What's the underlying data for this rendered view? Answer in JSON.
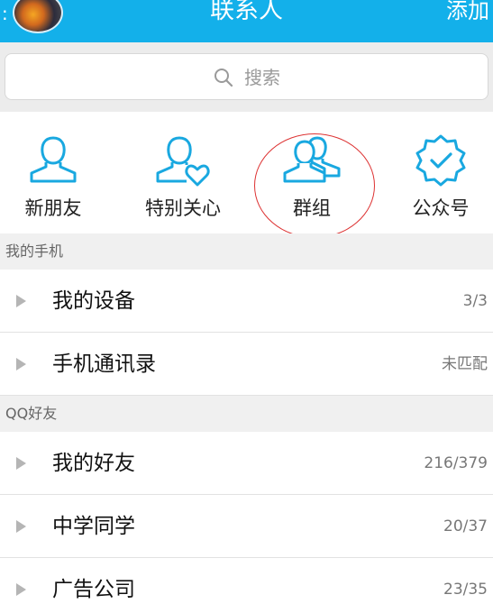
{
  "header": {
    "menu_glyph": ":",
    "title": "联系人",
    "add_label": "添加"
  },
  "search": {
    "placeholder": "搜索"
  },
  "quick_entries": [
    {
      "label": "新朋友",
      "icon": "new-friend-icon"
    },
    {
      "label": "特别关心",
      "icon": "special-care-icon"
    },
    {
      "label": "群组",
      "icon": "group-icon"
    },
    {
      "label": "公众号",
      "icon": "official-account-icon"
    }
  ],
  "sections": {
    "my_phone": "我的手机",
    "qq_friends": "QQ好友"
  },
  "phone_items": [
    {
      "label": "我的设备",
      "count": "3/3"
    },
    {
      "label": "手机通讯录",
      "count": "未匹配"
    }
  ],
  "friend_groups": [
    {
      "label": "我的好友",
      "count": "216/379"
    },
    {
      "label": "中学同学",
      "count": "20/37"
    },
    {
      "label": "广告公司",
      "count": "23/35"
    }
  ],
  "colors": {
    "header": "#13b0ea",
    "icon_accent": "#19a8e0",
    "annotation_circle": "#dd3333"
  }
}
